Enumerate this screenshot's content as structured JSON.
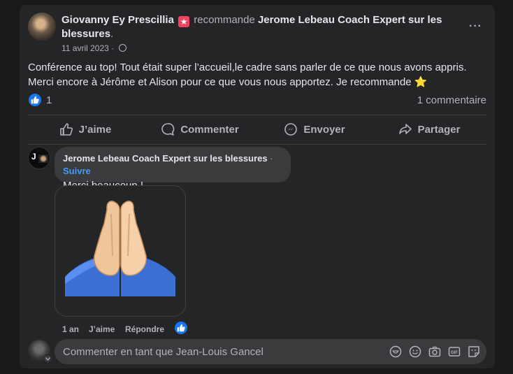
{
  "post": {
    "author": "Giovanny Ey Prescillia",
    "badge_glyph": "★",
    "verb": " recommande ",
    "page": "Jerome Lebeau Coach Expert sur les blessures",
    "period": ".",
    "date": "11 avril 2023",
    "date_sep": " · ",
    "more": "···",
    "text_line1": "Conférence au top! Tout était super l’accueil,le cadre sans parler de ce que nous avons appris.",
    "text_line2": "Merci encore à Jérôme et Alison pour ce que vous nous apportez. Je recommande ",
    "star": "⭐",
    "like_count": "1",
    "comment_count": "1 commentaire"
  },
  "actions": {
    "like": "J’aime",
    "comment": "Commenter",
    "send": "Envoyer",
    "share": "Partager"
  },
  "comment": {
    "avatar_letter": "J",
    "author": "Jerome Lebeau Coach Expert sur les blessures",
    "dot": " · ",
    "follow": "Suivre",
    "text": "Merci beaucoup !",
    "age": "1 an",
    "like": "J’aime",
    "reply": "Répondre"
  },
  "composer": {
    "placeholder": "Commenter en tant que Jean-Louis Gancel"
  },
  "icons": [
    "globe-icon",
    "more-icon",
    "thumbs-up-icon",
    "comment-icon",
    "messenger-icon",
    "share-icon",
    "praying-hands-emoji",
    "avatar-sticker-icon",
    "emoji-icon",
    "camera-icon",
    "gif-icon",
    "sticker-icon"
  ],
  "colors": {
    "background": "#18191a",
    "card": "#242526",
    "bubble": "#3a3b3c",
    "accent": "#1877f2",
    "link": "#4599ff",
    "badge": "#f3425f"
  }
}
